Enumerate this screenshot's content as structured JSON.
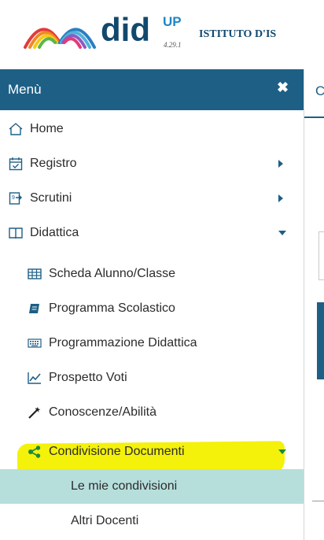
{
  "header": {
    "brand": "did",
    "brand_sup": "UP",
    "version": "4.29.1",
    "school": "ISTITUTO D'IS"
  },
  "sidebar": {
    "title": "Menù",
    "close": "✖",
    "items": [
      {
        "label": "Home",
        "icon": "home-icon"
      },
      {
        "label": "Registro",
        "icon": "calendar-icon"
      },
      {
        "label": "Scrutini",
        "icon": "scrutini-icon"
      },
      {
        "label": "Didattica",
        "icon": "book-icon"
      },
      {
        "label": "Scheda Alunno/Classe",
        "icon": "table-icon"
      },
      {
        "label": "Programma Scolastico",
        "icon": "notebook-icon"
      },
      {
        "label": "Programmazione Didattica",
        "icon": "keyboard-icon"
      },
      {
        "label": "Prospetto Voti",
        "icon": "chart-icon"
      },
      {
        "label": "Conoscenze/Abilità",
        "icon": "magic-icon"
      },
      {
        "label": "Condivisione Documenti",
        "icon": "share-icon"
      },
      {
        "label": "Le mie condivisioni"
      },
      {
        "label": "Altri Docenti"
      }
    ]
  },
  "right": {
    "tab_fragment": "C"
  },
  "colors": {
    "nav": "#1e5f85",
    "highlight": "#f4f10b",
    "active_sub": "#b6dfdc",
    "share_green": "#1b8a3d"
  }
}
